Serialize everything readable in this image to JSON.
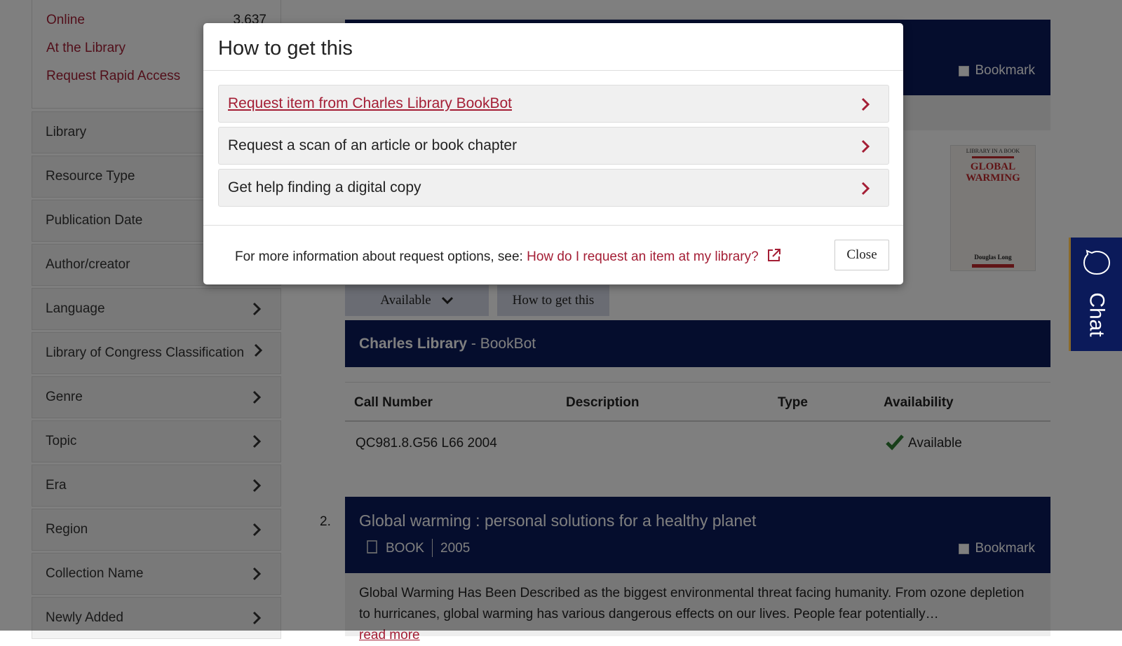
{
  "sidebar": {
    "availability": [
      {
        "label": "Online",
        "count": "3,637"
      },
      {
        "label": "At the Library",
        "count": ""
      },
      {
        "label": "Request Rapid Access",
        "count": ""
      }
    ],
    "facets": [
      "Library",
      "Resource Type",
      "Publication Date",
      "Author/creator",
      "Language",
      "Library of Congress Classification",
      "Genre",
      "Topic",
      "Era",
      "Region",
      "Collection Name",
      "Newly Added"
    ]
  },
  "result1": {
    "bookmark_label": "Bookmark",
    "cover": {
      "top": "LIBRARY IN A BOOK",
      "title1": "GLOBAL",
      "title2": "WARMING",
      "author": "Douglas Long"
    },
    "available_button": "Available",
    "how_button": "How to get this",
    "location": {
      "library": "Charles Library",
      "sep": " - ",
      "sub": "BookBot"
    },
    "table": {
      "headers": [
        "Call Number",
        "Description",
        "Type",
        "Availability"
      ],
      "row": {
        "call_number": "QC981.8.G56 L66 2004",
        "availability": "Available"
      }
    }
  },
  "result2": {
    "number": "2.",
    "title": "Global warming : personal solutions for a healthy planet",
    "format": "BOOK",
    "year": "2005",
    "bookmark_label": "Bookmark",
    "summary": "Global Warming Has Been Described as the biggest environmental threat facing humanity. From ozone depletion to hurricanes, global warming has various dangerous effects on our lives. People fear potentially…",
    "read_more": "read more"
  },
  "chat": {
    "label": "Chat"
  },
  "modal": {
    "title": "How to get this",
    "options": [
      "Request item from Charles Library BookBot",
      "Request a scan of an article or book chapter",
      "Get help finding a digital copy"
    ],
    "footer_text": "For more information about request options, see:",
    "footer_link": "How do I request an item at my library?",
    "close_label": "Close"
  },
  "colors": {
    "brand_navy": "#0b1a5a",
    "accent_red": "#a41e35",
    "check_green": "#2e7d32"
  }
}
